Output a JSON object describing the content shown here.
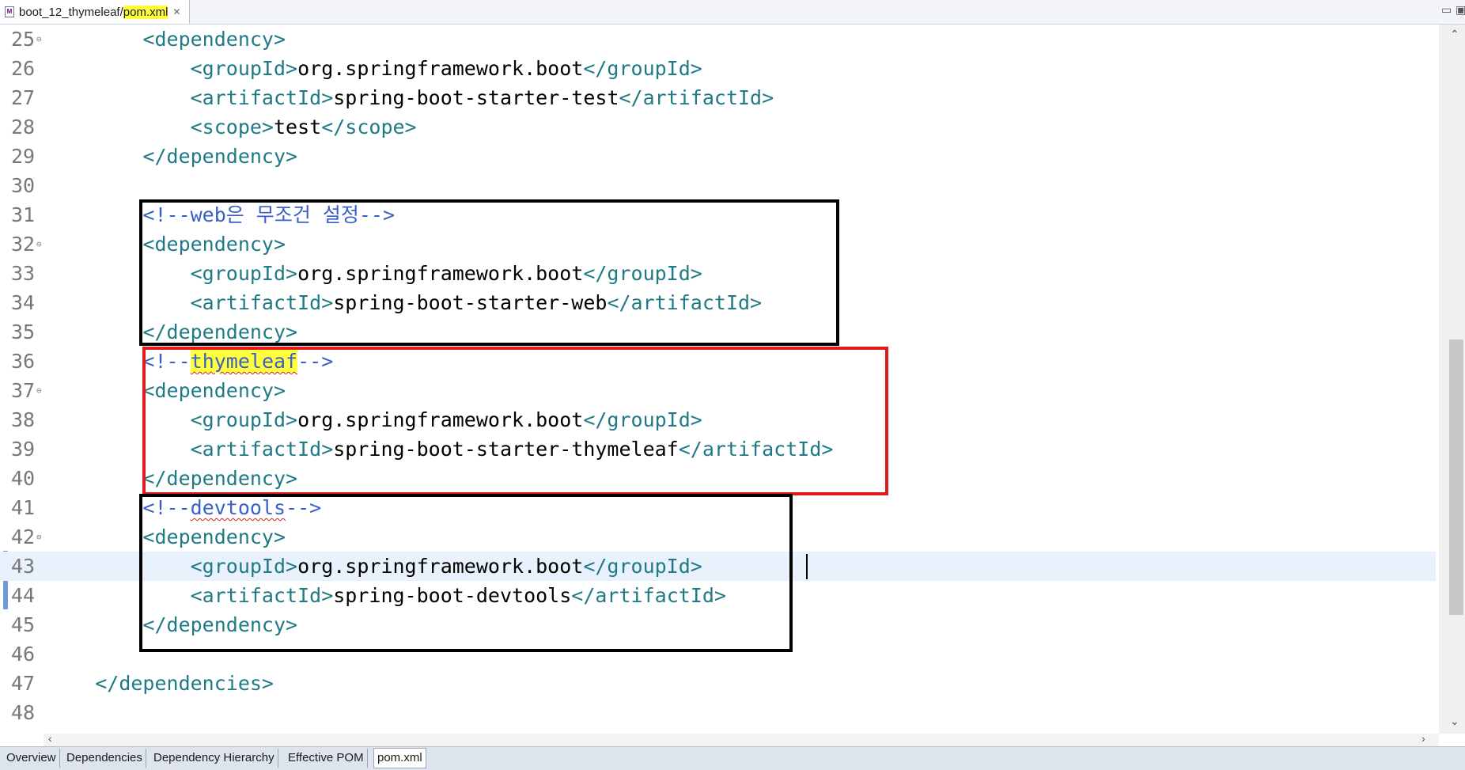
{
  "editor_tab": {
    "project_path": "boot_12_thymeleaf/",
    "file_name": "pom.xml",
    "close_glyph": "✕"
  },
  "window_controls": {
    "minimize": "▭",
    "maximize": "▣"
  },
  "lines": [
    {
      "n": "25",
      "fold": true,
      "parts": [
        {
          "t": "        ",
          "c": "txt"
        },
        {
          "t": "<dependency>",
          "c": "tag"
        }
      ]
    },
    {
      "n": "26",
      "fold": false,
      "parts": [
        {
          "t": "            ",
          "c": "txt"
        },
        {
          "t": "<groupId>",
          "c": "tag"
        },
        {
          "t": "org.springframework.boot",
          "c": "txt"
        },
        {
          "t": "</groupId>",
          "c": "tag"
        }
      ]
    },
    {
      "n": "27",
      "fold": false,
      "parts": [
        {
          "t": "            ",
          "c": "txt"
        },
        {
          "t": "<artifactId>",
          "c": "tag"
        },
        {
          "t": "spring-boot-starter-test",
          "c": "txt"
        },
        {
          "t": "</artifactId>",
          "c": "tag"
        }
      ]
    },
    {
      "n": "28",
      "fold": false,
      "parts": [
        {
          "t": "            ",
          "c": "txt"
        },
        {
          "t": "<scope>",
          "c": "tag"
        },
        {
          "t": "test",
          "c": "txt"
        },
        {
          "t": "</scope>",
          "c": "tag"
        }
      ]
    },
    {
      "n": "29",
      "fold": false,
      "parts": [
        {
          "t": "        ",
          "c": "txt"
        },
        {
          "t": "</dependency>",
          "c": "tag"
        }
      ]
    },
    {
      "n": "30",
      "fold": false,
      "parts": []
    },
    {
      "n": "31",
      "fold": false,
      "parts": [
        {
          "t": "        ",
          "c": "txt"
        },
        {
          "t": "<!--web은 무조건 설정-->",
          "c": "cmt"
        }
      ]
    },
    {
      "n": "32",
      "fold": true,
      "parts": [
        {
          "t": "        ",
          "c": "txt"
        },
        {
          "t": "<dependency>",
          "c": "tag"
        }
      ]
    },
    {
      "n": "33",
      "fold": false,
      "parts": [
        {
          "t": "            ",
          "c": "txt"
        },
        {
          "t": "<groupId>",
          "c": "tag"
        },
        {
          "t": "org.springframework.boot",
          "c": "txt"
        },
        {
          "t": "</groupId>",
          "c": "tag"
        }
      ]
    },
    {
      "n": "34",
      "fold": false,
      "parts": [
        {
          "t": "            ",
          "c": "txt"
        },
        {
          "t": "<artifactId>",
          "c": "tag"
        },
        {
          "t": "spring-boot-starter-web",
          "c": "txt"
        },
        {
          "t": "</artifactId>",
          "c": "tag"
        }
      ]
    },
    {
      "n": "35",
      "fold": false,
      "parts": [
        {
          "t": "        ",
          "c": "txt"
        },
        {
          "t": "</dependency>",
          "c": "tag"
        }
      ]
    },
    {
      "n": "36",
      "fold": false,
      "parts": [
        {
          "t": "        ",
          "c": "txt"
        },
        {
          "t": "<!--",
          "c": "cmt"
        },
        {
          "t": "thymeleaf",
          "c": "cmt hlbg squig"
        },
        {
          "t": "-->",
          "c": "cmt"
        }
      ]
    },
    {
      "n": "37",
      "fold": true,
      "parts": [
        {
          "t": "        ",
          "c": "txt"
        },
        {
          "t": "<dependency>",
          "c": "tag"
        }
      ]
    },
    {
      "n": "38",
      "fold": false,
      "parts": [
        {
          "t": "            ",
          "c": "txt"
        },
        {
          "t": "<groupId>",
          "c": "tag"
        },
        {
          "t": "org.springframework.boot",
          "c": "txt"
        },
        {
          "t": "</groupId>",
          "c": "tag"
        }
      ]
    },
    {
      "n": "39",
      "fold": false,
      "parts": [
        {
          "t": "            ",
          "c": "txt"
        },
        {
          "t": "<artifactId>",
          "c": "tag"
        },
        {
          "t": "spring-boot-starter-thymeleaf",
          "c": "txt"
        },
        {
          "t": "</artifactId>",
          "c": "tag"
        }
      ]
    },
    {
      "n": "40",
      "fold": false,
      "parts": [
        {
          "t": "        ",
          "c": "txt"
        },
        {
          "t": "</dependency>",
          "c": "tag"
        }
      ]
    },
    {
      "n": "41",
      "fold": false,
      "parts": [
        {
          "t": "        ",
          "c": "txt"
        },
        {
          "t": "<!--",
          "c": "cmt"
        },
        {
          "t": "devtools",
          "c": "cmt squig"
        },
        {
          "t": "-->",
          "c": "cmt"
        }
      ]
    },
    {
      "n": "42",
      "fold": true,
      "parts": [
        {
          "t": "        ",
          "c": "txt"
        },
        {
          "t": "<dependency>",
          "c": "tag"
        }
      ]
    },
    {
      "n": "43",
      "fold": false,
      "current": true,
      "parts": [
        {
          "t": "            ",
          "c": "txt"
        },
        {
          "t": "<groupId>",
          "c": "tag"
        },
        {
          "t": "org.springframework.boot",
          "c": "txt"
        },
        {
          "t": "</groupId>",
          "c": "tag"
        }
      ]
    },
    {
      "n": "44",
      "fold": false,
      "parts": [
        {
          "t": "            ",
          "c": "txt"
        },
        {
          "t": "<artifactId>",
          "c": "tag"
        },
        {
          "t": "spring-boot-devtools",
          "c": "txt"
        },
        {
          "t": "</artifactId>",
          "c": "tag"
        }
      ]
    },
    {
      "n": "45",
      "fold": false,
      "parts": [
        {
          "t": "        ",
          "c": "txt"
        },
        {
          "t": "</dependency>",
          "c": "tag"
        }
      ]
    },
    {
      "n": "46",
      "fold": false,
      "parts": []
    },
    {
      "n": "47",
      "fold": false,
      "parts": [
        {
          "t": "    ",
          "c": "txt"
        },
        {
          "t": "</dependencies>",
          "c": "tag"
        }
      ]
    },
    {
      "n": "48",
      "fold": false,
      "parts": []
    }
  ],
  "bottom_tabs": [
    {
      "label": "Overview",
      "active": false
    },
    {
      "label": "Dependencies",
      "active": false
    },
    {
      "label": "Dependency Hierarchy",
      "active": false
    },
    {
      "label": "Effective POM",
      "active": false
    },
    {
      "label": "pom.xml",
      "active": true
    }
  ],
  "colors": {
    "tag": "#1f7a85",
    "comment": "#3a5fc8",
    "highlight": "#ffff3b",
    "current_line": "#e8f1fc",
    "box_black": "#000000",
    "box_red": "#e11b1b"
  }
}
